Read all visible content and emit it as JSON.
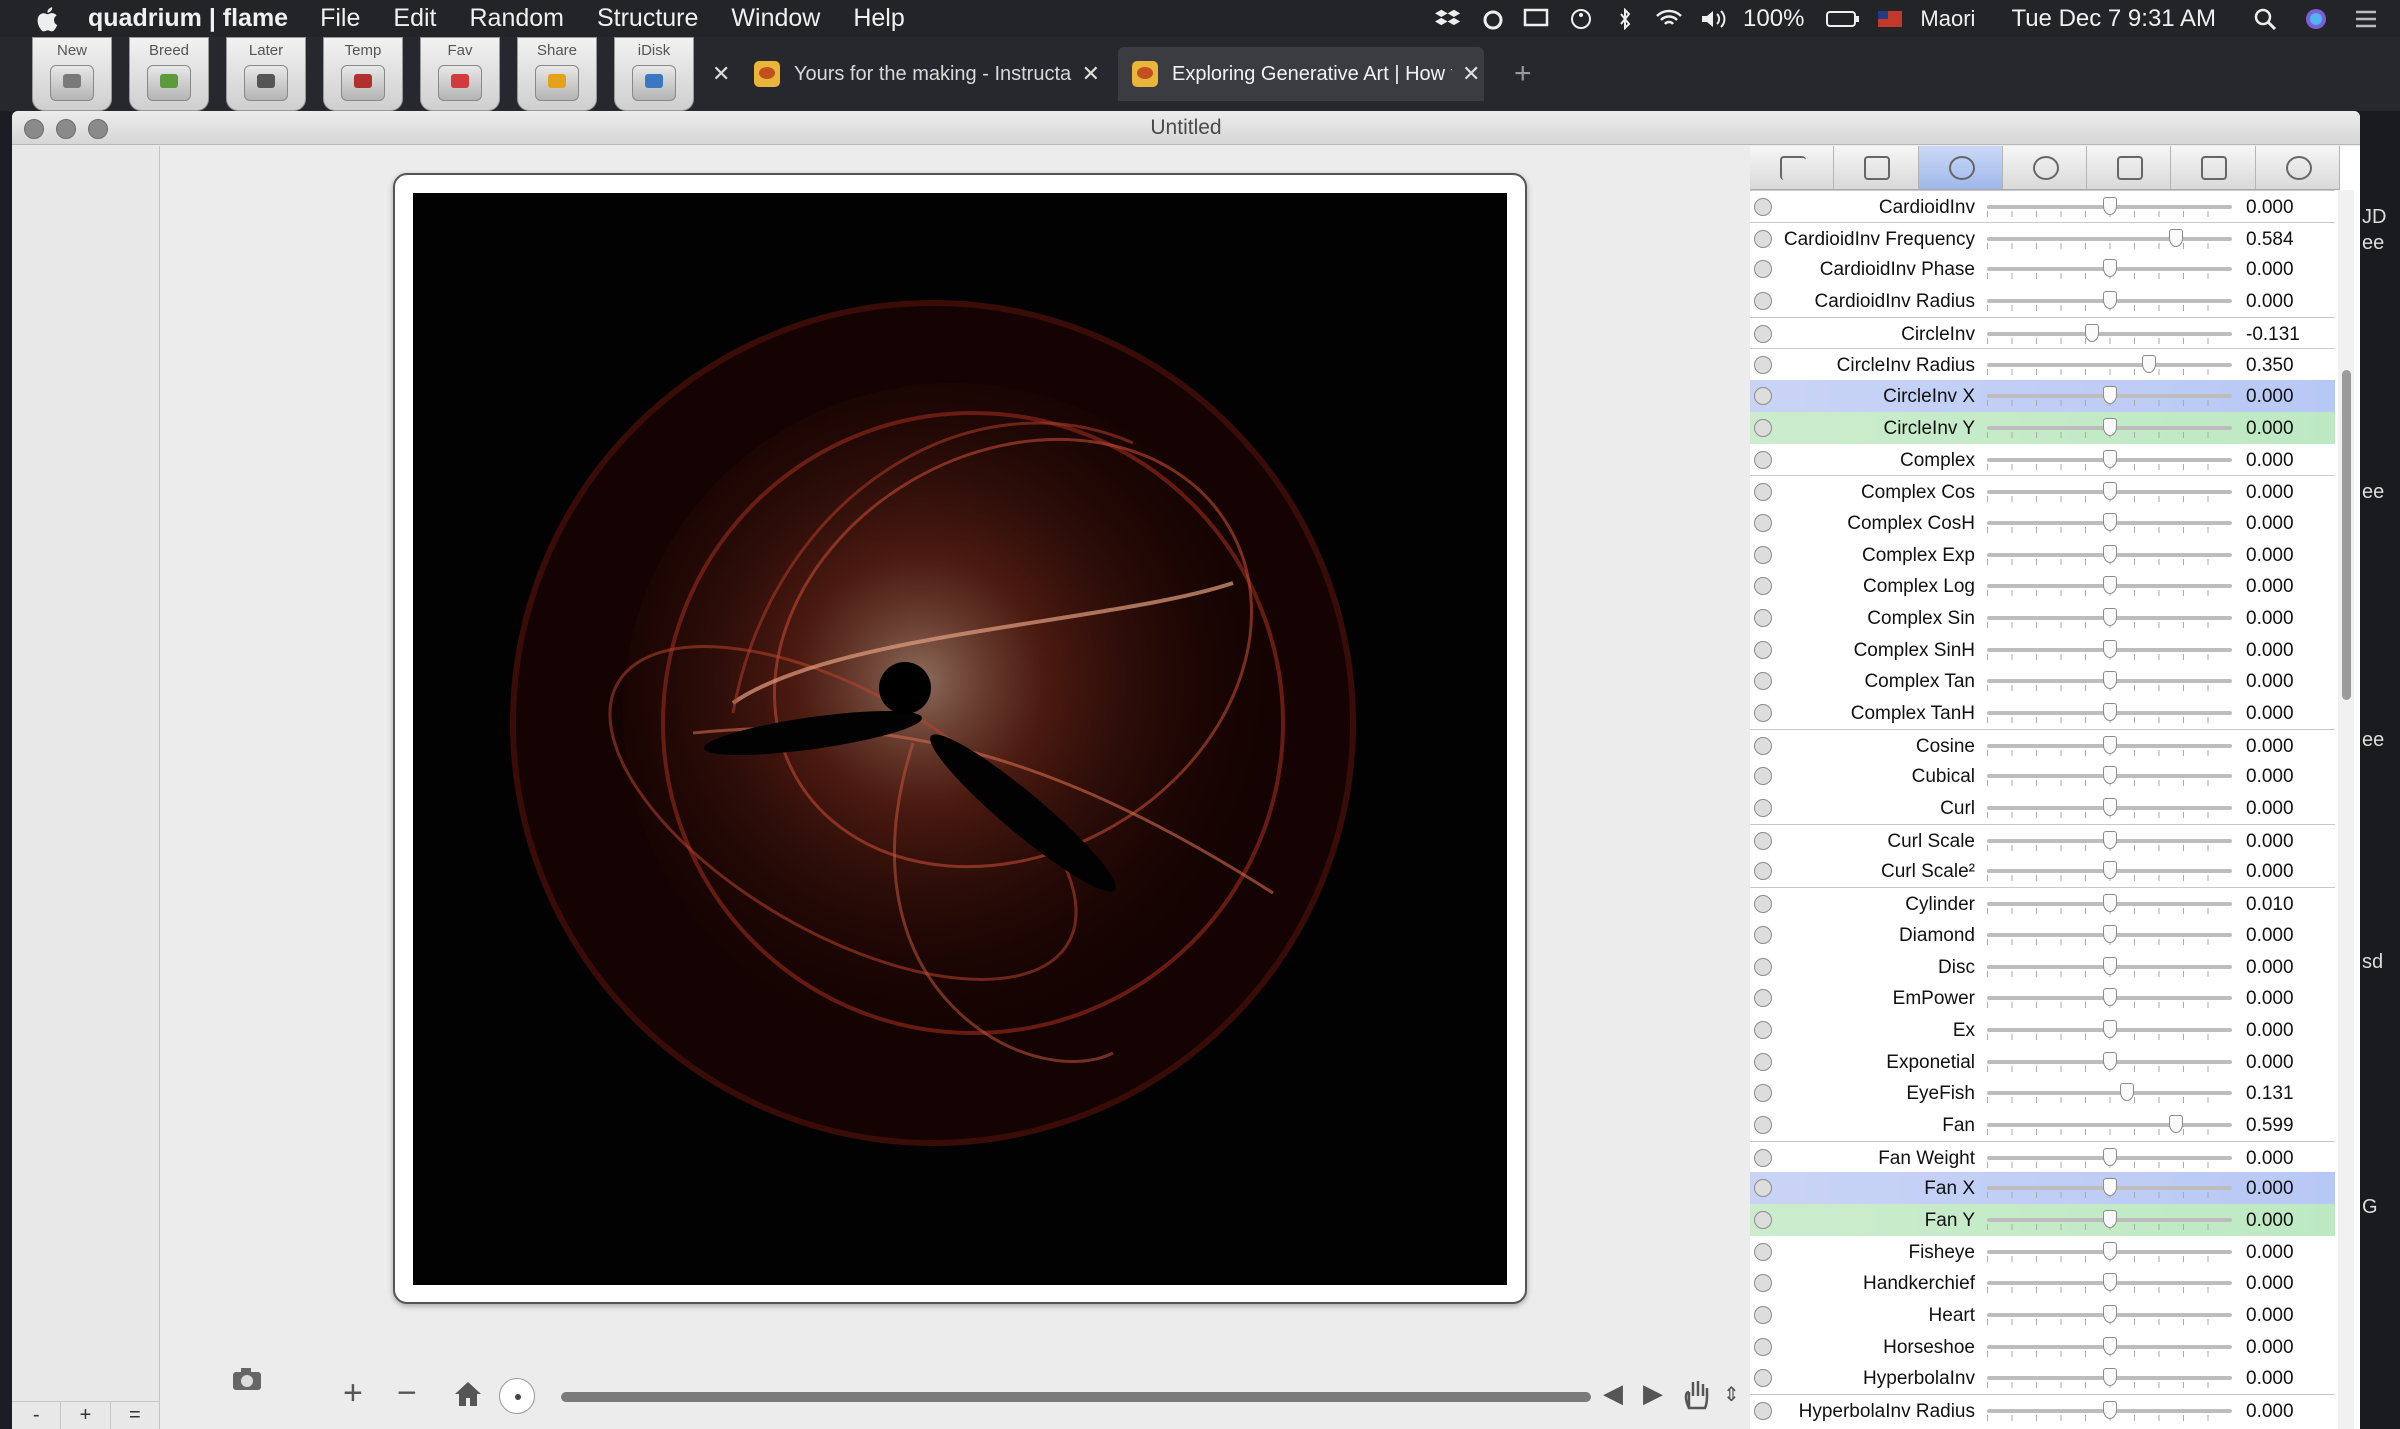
{
  "menubar": {
    "app_name": "quadrium | flame",
    "menus": [
      "File",
      "Edit",
      "Random",
      "Structure",
      "Window",
      "Help"
    ],
    "battery": "100%",
    "input_source": "Maori",
    "clock": "Tue Dec 7  9:31 AM"
  },
  "toolbar_buttons": [
    {
      "label": "New",
      "color": "#7a7a7a"
    },
    {
      "label": "Breed",
      "color": "#5c9a3b"
    },
    {
      "label": "Later",
      "color": "#555555"
    },
    {
      "label": "Temp",
      "color": "#b03030"
    },
    {
      "label": "Fav",
      "color": "#d23b3b"
    },
    {
      "label": "Share",
      "color": "#e3a21a"
    },
    {
      "label": "iDisk",
      "color": "#3b78c2"
    }
  ],
  "tabs": [
    {
      "title": "Yours for the making - Instructa"
    },
    {
      "title": "Exploring Generative Art | How t"
    }
  ],
  "window": {
    "title": "Untitled"
  },
  "left_buttons": [
    "-",
    "+",
    "="
  ],
  "panel": {
    "rows": [
      {
        "label": "CardioidInv",
        "value": "0.000",
        "pos": 0.5,
        "style": "sep"
      },
      {
        "label": "CardioidInv Frequency",
        "value": "0.584",
        "pos": 0.77,
        "style": "sep"
      },
      {
        "label": "CardioidInv Phase",
        "value": "0.000",
        "pos": 0.5,
        "style": ""
      },
      {
        "label": "CardioidInv Radius",
        "value": "0.000",
        "pos": 0.5,
        "style": ""
      },
      {
        "label": "CircleInv",
        "value": "-0.131",
        "pos": 0.43,
        "style": "sep"
      },
      {
        "label": "CircleInv Radius",
        "value": "0.350",
        "pos": 0.66,
        "style": "sep"
      },
      {
        "label": "CircleInv X",
        "value": "0.000",
        "pos": 0.5,
        "style": "blue"
      },
      {
        "label": "CircleInv Y",
        "value": "0.000",
        "pos": 0.5,
        "style": "green"
      },
      {
        "label": "Complex",
        "value": "0.000",
        "pos": 0.5,
        "style": ""
      },
      {
        "label": "Complex Cos",
        "value": "0.000",
        "pos": 0.5,
        "style": "sep"
      },
      {
        "label": "Complex CosH",
        "value": "0.000",
        "pos": 0.5,
        "style": ""
      },
      {
        "label": "Complex Exp",
        "value": "0.000",
        "pos": 0.5,
        "style": ""
      },
      {
        "label": "Complex Log",
        "value": "0.000",
        "pos": 0.5,
        "style": ""
      },
      {
        "label": "Complex Sin",
        "value": "0.000",
        "pos": 0.5,
        "style": ""
      },
      {
        "label": "Complex SinH",
        "value": "0.000",
        "pos": 0.5,
        "style": ""
      },
      {
        "label": "Complex Tan",
        "value": "0.000",
        "pos": 0.5,
        "style": ""
      },
      {
        "label": "Complex TanH",
        "value": "0.000",
        "pos": 0.5,
        "style": ""
      },
      {
        "label": "Cosine",
        "value": "0.000",
        "pos": 0.5,
        "style": "sep"
      },
      {
        "label": "Cubical",
        "value": "0.000",
        "pos": 0.5,
        "style": ""
      },
      {
        "label": "Curl",
        "value": "0.000",
        "pos": 0.5,
        "style": ""
      },
      {
        "label": "Curl Scale",
        "value": "0.000",
        "pos": 0.5,
        "style": "sep"
      },
      {
        "label": "Curl Scale²",
        "value": "0.000",
        "pos": 0.5,
        "style": ""
      },
      {
        "label": "Cylinder",
        "value": "0.010",
        "pos": 0.5,
        "style": "sep"
      },
      {
        "label": "Diamond",
        "value": "0.000",
        "pos": 0.5,
        "style": ""
      },
      {
        "label": "Disc",
        "value": "0.000",
        "pos": 0.5,
        "style": ""
      },
      {
        "label": "EmPower",
        "value": "0.000",
        "pos": 0.5,
        "style": ""
      },
      {
        "label": "Ex",
        "value": "0.000",
        "pos": 0.5,
        "style": ""
      },
      {
        "label": "Exponetial",
        "value": "0.000",
        "pos": 0.5,
        "style": ""
      },
      {
        "label": "EyeFish",
        "value": "0.131",
        "pos": 0.57,
        "style": ""
      },
      {
        "label": "Fan",
        "value": "0.599",
        "pos": 0.77,
        "style": ""
      },
      {
        "label": "Fan Weight",
        "value": "0.000",
        "pos": 0.5,
        "style": "sep"
      },
      {
        "label": "Fan X",
        "value": "0.000",
        "pos": 0.5,
        "style": "blue"
      },
      {
        "label": "Fan Y",
        "value": "0.000",
        "pos": 0.5,
        "style": "green"
      },
      {
        "label": "Fisheye",
        "value": "0.000",
        "pos": 0.5,
        "style": ""
      },
      {
        "label": "Handkerchief",
        "value": "0.000",
        "pos": 0.5,
        "style": ""
      },
      {
        "label": "Heart",
        "value": "0.000",
        "pos": 0.5,
        "style": ""
      },
      {
        "label": "Horseshoe",
        "value": "0.000",
        "pos": 0.5,
        "style": ""
      },
      {
        "label": "HyperbolaInv",
        "value": "0.000",
        "pos": 0.5,
        "style": ""
      },
      {
        "label": "HyperbolaInv Radius",
        "value": "0.000",
        "pos": 0.5,
        "style": "sep"
      }
    ]
  },
  "behind_window_text": [
    "JD",
    "ee",
    "ee",
    "ee",
    "sd",
    "G"
  ]
}
